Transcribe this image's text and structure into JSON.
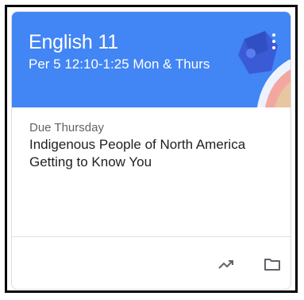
{
  "course": {
    "title": "English 11",
    "section": "Per 5 12:10-1:25 Mon & Thurs"
  },
  "work": {
    "due_label": "Due Thursday",
    "items": [
      "Indigenous People of North America",
      "Getting to Know You"
    ]
  },
  "icons": {
    "more": "more-vert-icon",
    "trend": "trending-up-icon",
    "folder": "folder-icon"
  },
  "colors": {
    "header": "#4285f4",
    "text_primary": "#202124",
    "text_secondary": "#5f6368"
  }
}
